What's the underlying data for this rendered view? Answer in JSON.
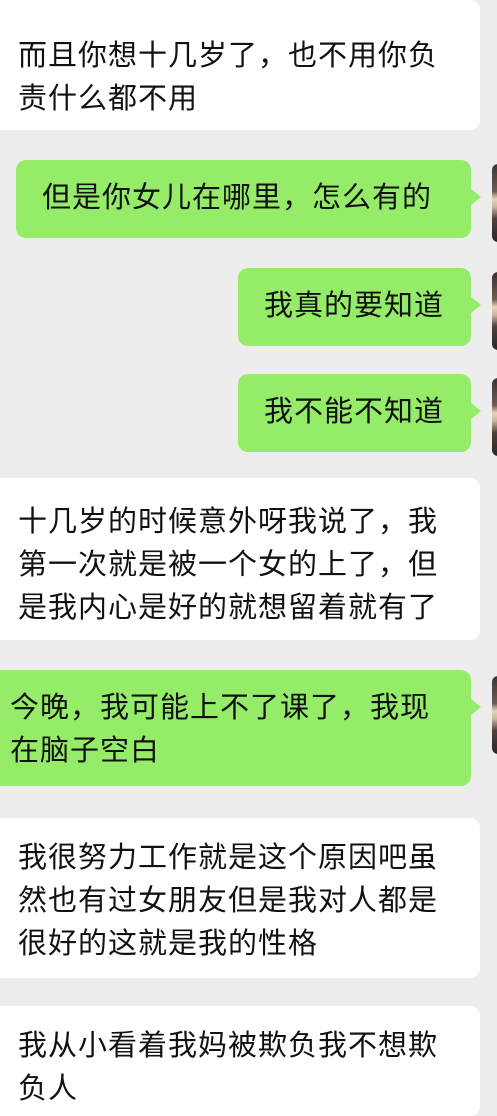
{
  "messages": [
    {
      "side": "received",
      "text": "而且你想十几岁了，也不用你负责什么都不用"
    },
    {
      "side": "sent",
      "text": "但是你女儿在哪里，怎么有的"
    },
    {
      "side": "sent",
      "text": "我真的要知道"
    },
    {
      "side": "sent",
      "text": "我不能不知道"
    },
    {
      "side": "received",
      "text": "十几岁的时候意外呀我说了，我第一次就是被一个女的上了，但是我内心是好的就想留着就有了"
    },
    {
      "side": "sent",
      "text": "今晚，我可能上不了课了，我现在脑子空白"
    },
    {
      "side": "received",
      "text": "我很努力工作就是这个原因吧虽然也有过女朋友但是我对人都是很好的这就是我的性格"
    },
    {
      "side": "received",
      "text": "我从小看着我妈被欺负我不想欺负人"
    }
  ],
  "colors": {
    "background": "#ededed",
    "sent_bubble": "#95ec69",
    "received_bubble": "#ffffff",
    "text": "#111111"
  }
}
